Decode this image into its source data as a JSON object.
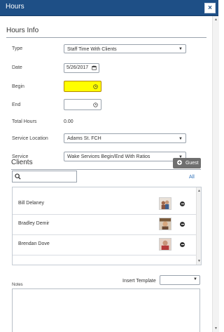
{
  "window": {
    "title": "Hours",
    "close_label": "×"
  },
  "section": {
    "title": "Hours Info"
  },
  "form": {
    "type": {
      "label": "Type",
      "value": "Staff Time With Clients"
    },
    "date": {
      "label": "Date",
      "value": "5/26/2017"
    },
    "begin": {
      "label": "Begin",
      "value": ""
    },
    "end": {
      "label": "End",
      "value": ""
    },
    "total_hours": {
      "label": "Total Hours",
      "value": "0.00"
    },
    "service_location": {
      "label": "Service Location",
      "value": "Adams St. FCH"
    },
    "service": {
      "label": "Service",
      "value": "Wake Services Begin/End With Ratios"
    }
  },
  "clients": {
    "title": "Clients",
    "guest_label": "Guest",
    "search_placeholder": "",
    "all_label": "All",
    "items": [
      {
        "name": "Bill Delaney"
      },
      {
        "name": "Bradley Demir"
      },
      {
        "name": "Brendan Dove"
      }
    ]
  },
  "notes": {
    "label": "Notes",
    "insert_template_label": "Insert Template",
    "template_value": ""
  },
  "colors": {
    "titlebar": "#1e4f86",
    "begin_highlight": "#ffff00",
    "link": "#2d6fb8",
    "guest_button": "#6f6f6f"
  }
}
